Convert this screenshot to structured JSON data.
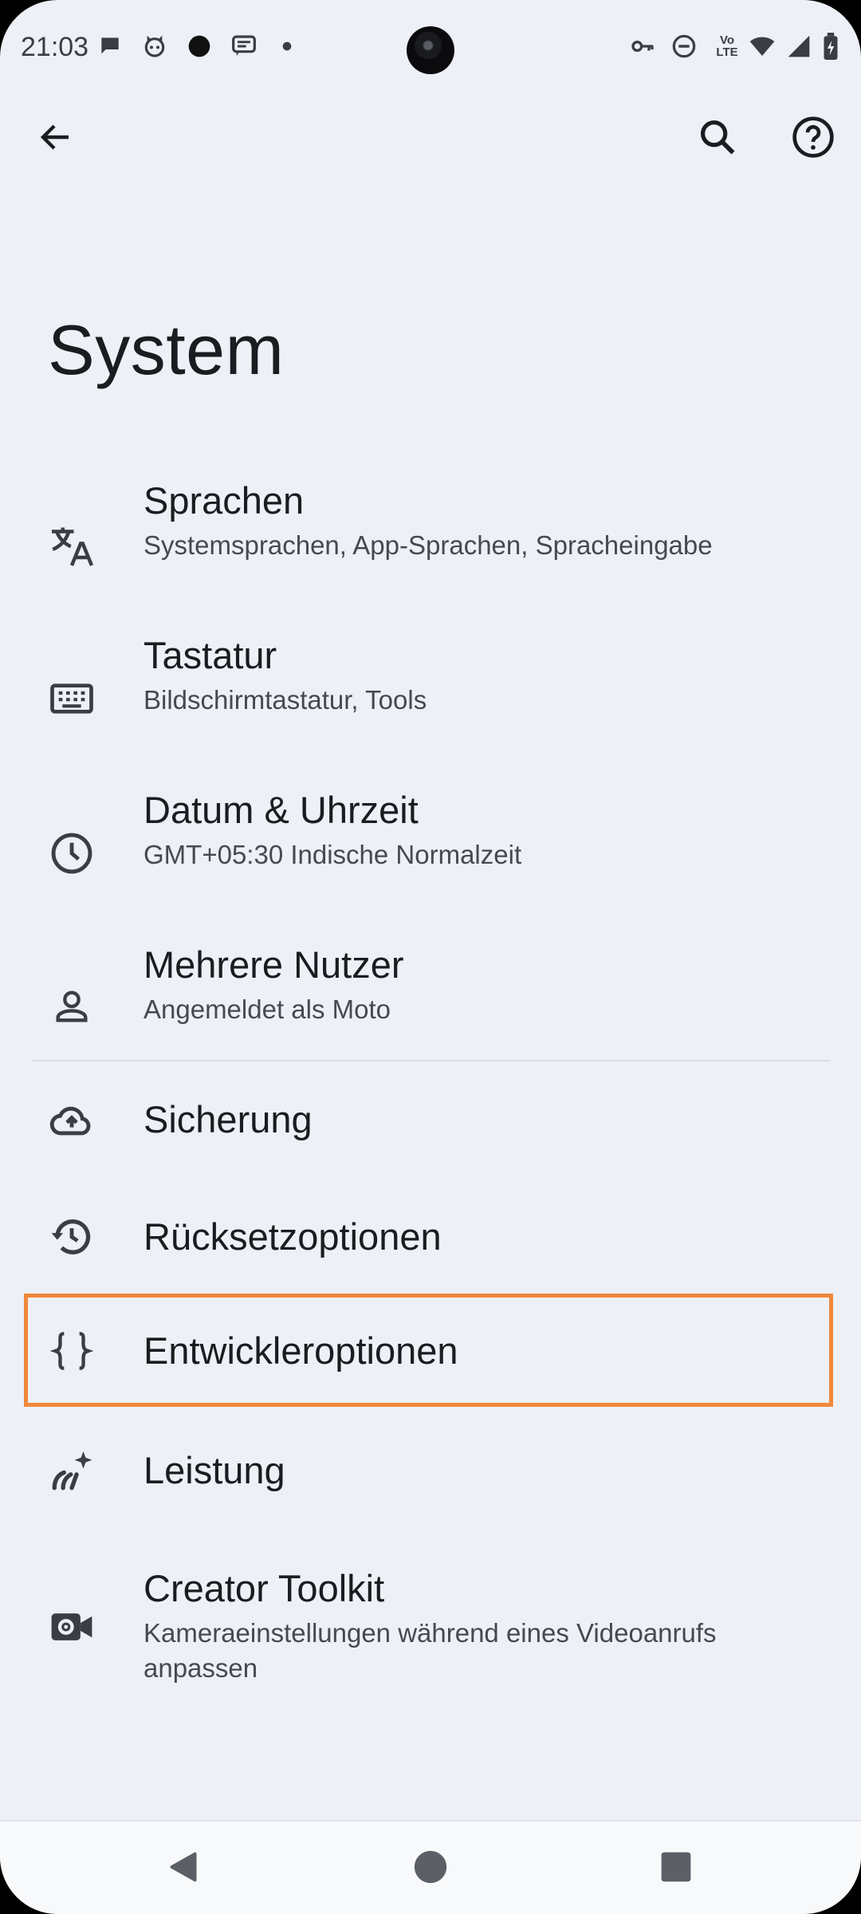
{
  "status_bar": {
    "time": "21:03",
    "left_icons": [
      "chat-bubble-icon",
      "cat-face-icon",
      "dot-filled-icon",
      "messages-icon",
      "small-dot-icon"
    ],
    "right_icons": [
      "vpn-key-icon",
      "do-not-disturb-icon",
      "volte-icon",
      "wifi-icon",
      "cell-signal-icon",
      "battery-icon"
    ],
    "volte_label_top": "Vo",
    "volte_label_bottom": "LTE"
  },
  "app_bar": {
    "back_icon": "arrow-back-icon",
    "search_icon": "search-icon",
    "help_icon": "help-icon"
  },
  "page_title": "System",
  "items": [
    {
      "title": "Sprachen",
      "summary": "Systemsprachen, App-Sprachen, Spracheingabe",
      "icon": "translate-icon"
    },
    {
      "title": "Tastatur",
      "summary": "Bildschirmtastatur, Tools",
      "icon": "keyboard-icon"
    },
    {
      "title": "Datum & Uhrzeit",
      "summary": "GMT+05:30 Indische Normalzeit",
      "icon": "clock-icon"
    },
    {
      "title": "Mehrere Nutzer",
      "summary": "Angemeldet als Moto",
      "icon": "person-icon"
    },
    {
      "title": "Sicherung",
      "icon": "cloud-upload-icon"
    },
    {
      "title": "Rücksetzoptionen",
      "icon": "history-icon"
    },
    {
      "title": "Entwickleroptionen",
      "icon": "braces-icon"
    },
    {
      "title": "Leistung",
      "icon": "performance-icon"
    },
    {
      "title": "Creator Toolkit",
      "summary": "Kameraeinstellungen während eines Videoanrufs anpassen",
      "icon": "video-settings-icon"
    }
  ],
  "highlighted_item": "Entwickleroptionen",
  "colors": {
    "background": "#eef0f7",
    "highlight": "#f0883b",
    "text_primary": "#1b1c20",
    "text_secondary": "#464950"
  },
  "nav_bar": {
    "back_icon": "nav-back-icon",
    "home_icon": "nav-home-icon",
    "recents_icon": "nav-recents-icon"
  }
}
